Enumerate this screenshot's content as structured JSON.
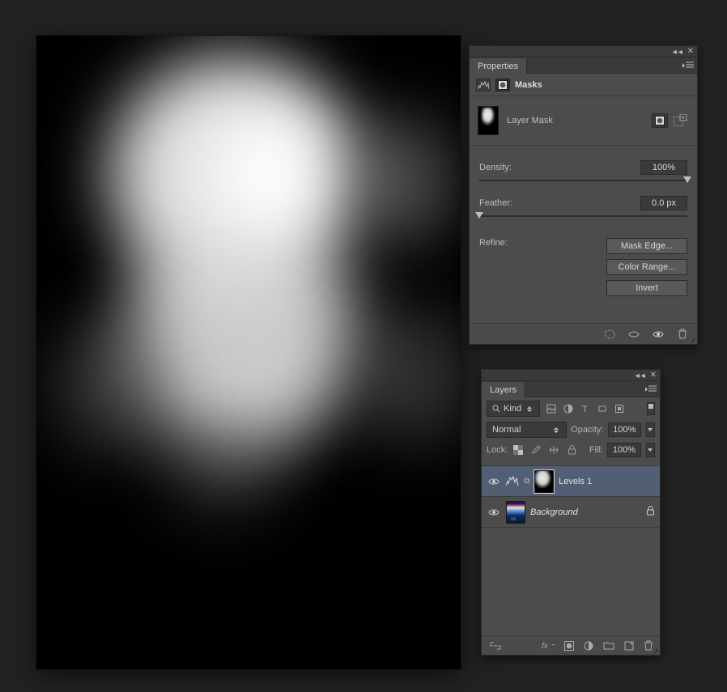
{
  "properties": {
    "tab_label": "Properties",
    "type_label": "Masks",
    "layer_mask_label": "Layer Mask",
    "density_label": "Density:",
    "density_value": "100%",
    "density_fraction": 1.0,
    "feather_label": "Feather:",
    "feather_value": "0.0 px",
    "feather_fraction": 0.0,
    "refine_label": "Refine:",
    "buttons": {
      "mask_edge": "Mask Edge...",
      "color_range": "Color Range...",
      "invert": "Invert"
    }
  },
  "layers": {
    "tab_label": "Layers",
    "filter_kind": "Kind",
    "blend_mode": "Normal",
    "opacity_label": "Opacity:",
    "opacity_value": "100%",
    "lock_label": "Lock:",
    "fill_label": "Fill:",
    "fill_value": "100%",
    "entries": [
      {
        "name": "Levels 1",
        "italic": false,
        "selected": true,
        "locked": false,
        "kind": "adjustment-levels"
      },
      {
        "name": "Background",
        "italic": true,
        "selected": false,
        "locked": true,
        "kind": "image"
      }
    ]
  }
}
